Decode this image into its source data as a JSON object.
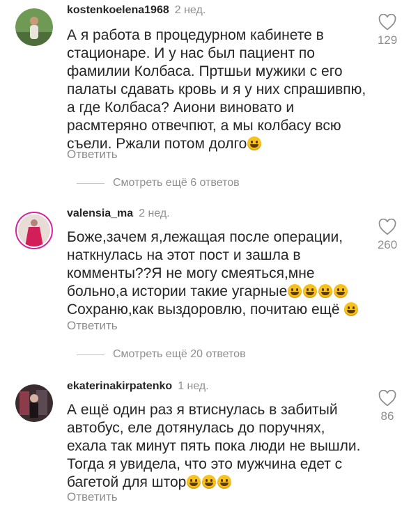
{
  "comments": [
    {
      "username": "kostenkoelena1968",
      "time": "2 нед.",
      "text": "А я работа в процедурном кабинете в стационаре. И у нас был пациент по фамилии Колбаса. Пртшьи мужики с его палаты сдавать кровь и я у них спрашивпю, а где Колбаса? Аиони виновато и расмтеряно отвечпют, а мы колбасу всю съели. Ржали потом долго",
      "likes": "129",
      "reply_label": "Ответить",
      "more_replies": "Смотреть ещё 6 ответов"
    },
    {
      "username": "valensia_ma",
      "time": "2 нед.",
      "text_line1": "Боже,зачем я,лежащая после операции, наткнулась на этот пост и зашла в комменты??Я не могу смеяться,мне больно,а истории такие угарные",
      "text_line2": "Сохраню,как выздоровлю, почитаю ещё",
      "likes": "260",
      "reply_label": "Ответить",
      "more_replies": "Смотреть ещё 20 ответов"
    },
    {
      "username": "ekaterinakirpatenko",
      "time": "1 нед.",
      "text": "А ещё один раз я втиснулась в забитый автобус, еле дотянулась до поручнях, ехала так минут пять пока люди не вышли. Тогда я увидела, что это мужчина едет с багетой для штор",
      "likes": "86",
      "reply_label": "Ответить"
    }
  ],
  "icons": {
    "like": "heart-outline-icon",
    "emoji": "laughing-emoji-icon"
  },
  "colors": {
    "text": "#262626",
    "muted": "#8e8e8e",
    "emoji": "#f7c21e"
  }
}
